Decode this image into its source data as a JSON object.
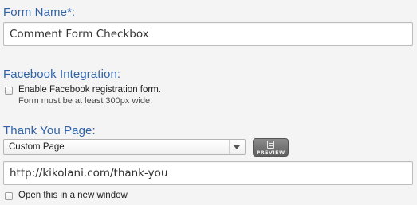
{
  "form_name": {
    "label": "Form Name*:",
    "value": "Comment Form Checkbox"
  },
  "facebook": {
    "label": "Facebook Integration:",
    "checkbox_label": "Enable Facebook registration form.",
    "note": "Form must be at least 300px wide.",
    "checked": false
  },
  "thank_you": {
    "label": "Thank You Page:",
    "select_value": "Custom Page",
    "preview_label": "PREVIEW",
    "url_value": "http://kikolani.com/thank-you",
    "new_window_label": "Open this in a new window",
    "new_window_checked": false
  },
  "colors": {
    "label_blue": "#2f63a8",
    "background": "#f4f4f4"
  },
  "icons": {
    "select_arrow": "chevron-down-icon",
    "preview": "document-icon"
  }
}
